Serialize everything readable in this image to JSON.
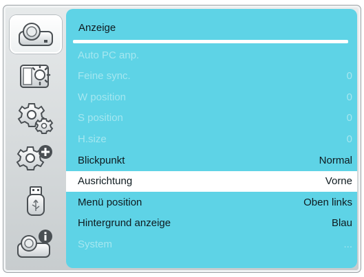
{
  "sidebar": {
    "items": [
      {
        "icon": "projector-icon",
        "selected": true
      },
      {
        "icon": "brightness-picture-icon",
        "selected": false
      },
      {
        "icon": "gear-icon",
        "selected": false
      },
      {
        "icon": "advanced-gear-icon",
        "selected": false
      },
      {
        "icon": "usb-icon",
        "selected": false
      },
      {
        "icon": "projector-info-icon",
        "selected": false
      }
    ]
  },
  "menu": {
    "title": "Anzeige",
    "rows": [
      {
        "label": "Auto PC anp.",
        "value": "",
        "enabled": false,
        "highlight": false
      },
      {
        "label": "Feine sync.",
        "value": "0",
        "enabled": false,
        "highlight": false
      },
      {
        "label": "W position",
        "value": "0",
        "enabled": false,
        "highlight": false
      },
      {
        "label": "S position",
        "value": "0",
        "enabled": false,
        "highlight": false
      },
      {
        "label": "H.size",
        "value": "0",
        "enabled": false,
        "highlight": false
      },
      {
        "label": "Blickpunkt",
        "value": "Normal",
        "enabled": true,
        "highlight": false
      },
      {
        "label": "Ausrichtung",
        "value": "Vorne",
        "enabled": true,
        "highlight": true
      },
      {
        "label": "Menü position",
        "value": "Oben links",
        "enabled": true,
        "highlight": false
      },
      {
        "label": "Hintergrund anzeige",
        "value": "Blau",
        "enabled": true,
        "highlight": false
      },
      {
        "label": "System",
        "value": "...",
        "enabled": false,
        "highlight": false
      }
    ]
  },
  "colors": {
    "panel": "#5ed3e6",
    "text": "#0e1a1f",
    "disabled_text": "#a5e7f0",
    "highlight": "#ffffff"
  }
}
